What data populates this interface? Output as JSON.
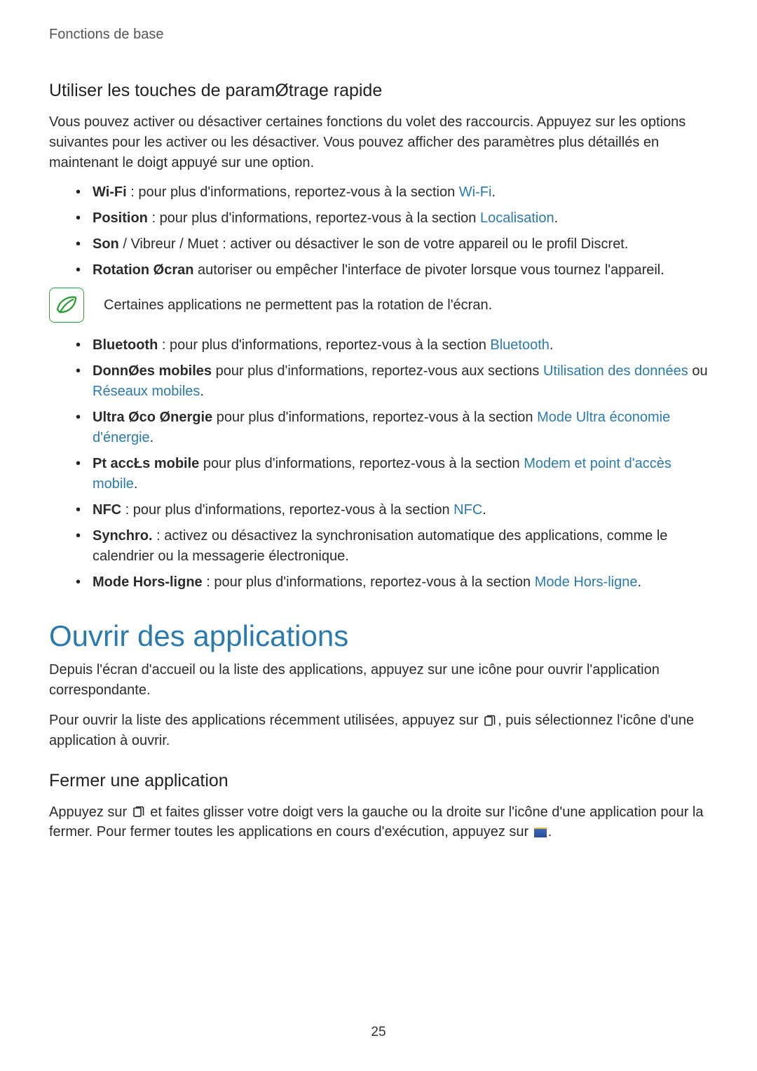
{
  "header": "Fonctions de base",
  "section1": {
    "heading": "Utiliser les touches de paramØtrage rapide",
    "intro": "Vous pouvez activer ou désactiver certaines fonctions du volet des raccourcis. Appuyez sur les options suivantes pour les activer ou les désactiver. Vous pouvez afficher des paramètres plus détaillés en maintenant le doigt appuyé sur une option.",
    "bullets1": [
      {
        "label": "Wi-Fi",
        "sep": " : ",
        "text": "pour plus d'informations, reportez-vous à la section ",
        "link": "Wi-Fi",
        "after": "."
      },
      {
        "label": "Position",
        "sep": " : ",
        "text": "pour plus d'informations, reportez-vous à la section ",
        "link": "Localisation",
        "after": "."
      },
      {
        "label": "Son",
        "sep": " / ",
        "text_plain": "Vibreur / Muet : activer ou désactiver le son de votre appareil ou le profil Discret."
      },
      {
        "label": "Rotation Øcran",
        "sep": " ",
        "text_plain": "autoriser ou empêcher l'interface de pivoter lorsque vous tournez l'appareil."
      }
    ],
    "note": "Certaines applications ne permettent pas la rotation de l'écran.",
    "bullets2": [
      {
        "label": "Bluetooth",
        "sep": " : ",
        "text": "pour plus d'informations, reportez-vous à la section ",
        "link": "Bluetooth",
        "after": "."
      },
      {
        "label": "DonnØes mobiles",
        "sep": " ",
        "text": "pour plus d'informations, reportez-vous aux sections ",
        "link": "Utilisation des données",
        "mid": " ou ",
        "link2": "Réseaux mobiles",
        "after": "."
      },
      {
        "label": "Ultra Øco Ønergie",
        "sep": " ",
        "text": "pour plus d'informations, reportez-vous à la section ",
        "link": "Mode Ultra économie d'énergie",
        "after": "."
      },
      {
        "label": "Pt accŁs mobile",
        "sep": " ",
        "text": "pour plus d'informations, reportez-vous à la section ",
        "link": "Modem et point d'accès mobile",
        "after": "."
      },
      {
        "label": "NFC",
        "sep": " : ",
        "text": "pour plus d'informations, reportez-vous à la section ",
        "link": "NFC",
        "after": "."
      },
      {
        "label": "Synchro.",
        "sep": " : ",
        "text_plain": "activez ou désactivez la synchronisation automatique des applications, comme le calendrier ou la messagerie électronique."
      },
      {
        "label": "Mode Hors-ligne",
        "sep": " : ",
        "text": "pour plus d'informations, reportez-vous à la section ",
        "link": "Mode Hors-ligne",
        "after": "."
      }
    ]
  },
  "section2": {
    "heading": "Ouvrir des applications",
    "p1": "Depuis l'écran d'accueil ou la liste des applications, appuyez sur une icône pour ouvrir l'application correspondante.",
    "p2a": "Pour ouvrir la liste des applications récemment utilisées, appuyez sur ",
    "p2b": ", puis sélectionnez l'icône d'une application à ouvrir.",
    "sub_heading": "Fermer une application",
    "p3a": "Appuyez sur ",
    "p3b": " et faites glisser votre doigt vers la gauche ou la droite sur l'icône d'une application pour la fermer. Pour fermer toutes les applications en cours d'exécution, appuyez sur ",
    "p3c": "."
  },
  "page_number": "25"
}
